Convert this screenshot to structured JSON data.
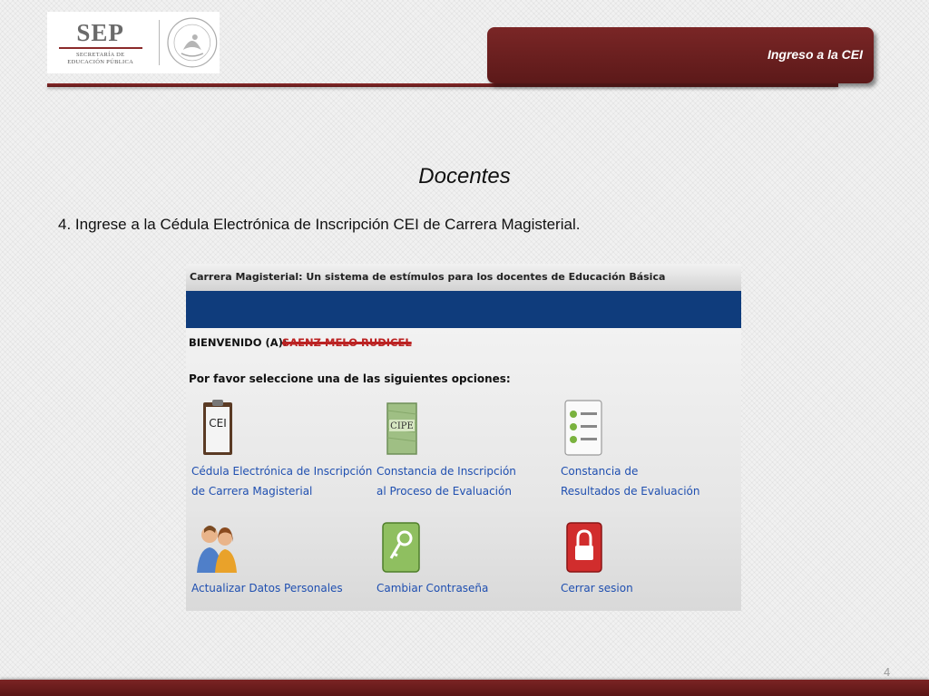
{
  "header": {
    "logo_name": "SEP",
    "logo_subtitle_line1": "SECRETARÍA DE",
    "logo_subtitle_line2": "EDUCACIÓN PÚBLICA",
    "seal_text": "ESTADOS UNIDOS MEXICANOS",
    "tab_label": "Ingreso a la CEI"
  },
  "slide": {
    "title": "Docentes",
    "step_text": "4. Ingrese a la Cédula Electrónica de Inscripción CEI de Carrera Magisterial.",
    "page_number": "4"
  },
  "screenshot": {
    "top_bar": "Carrera Magisterial: Un sistema de estímulos para los docentes de Educación Básica",
    "welcome_label": "BIENVENIDO (A):",
    "welcome_name": "SAENZ MELO RUDICEL",
    "prompt": "Por favor seleccione una de las siguientes opciones:",
    "options": [
      {
        "line1": "Cédula Electrónica de Inscripción",
        "line2": "de Carrera Magisterial",
        "icon": "cei-clipboard-icon",
        "icon_text": "CEI"
      },
      {
        "line1": "Constancia de Inscripción",
        "line2": "al Proceso de Evaluación",
        "icon": "cipe-document-icon",
        "icon_text": "CIPE"
      },
      {
        "line1": "Constancia de",
        "line2": "Resultados de Evaluación",
        "icon": "checklist-icon"
      },
      {
        "line1": "Actualizar Datos Personales",
        "icon": "users-icon"
      },
      {
        "line1": "Cambiar Contraseña",
        "icon": "key-icon"
      },
      {
        "line1": "Cerrar sesion",
        "icon": "lock-icon"
      }
    ]
  },
  "colors": {
    "accent_maroon": "#6b1f1f",
    "screen_blue": "#0f3c7c",
    "link_blue": "#1f4fb0"
  }
}
